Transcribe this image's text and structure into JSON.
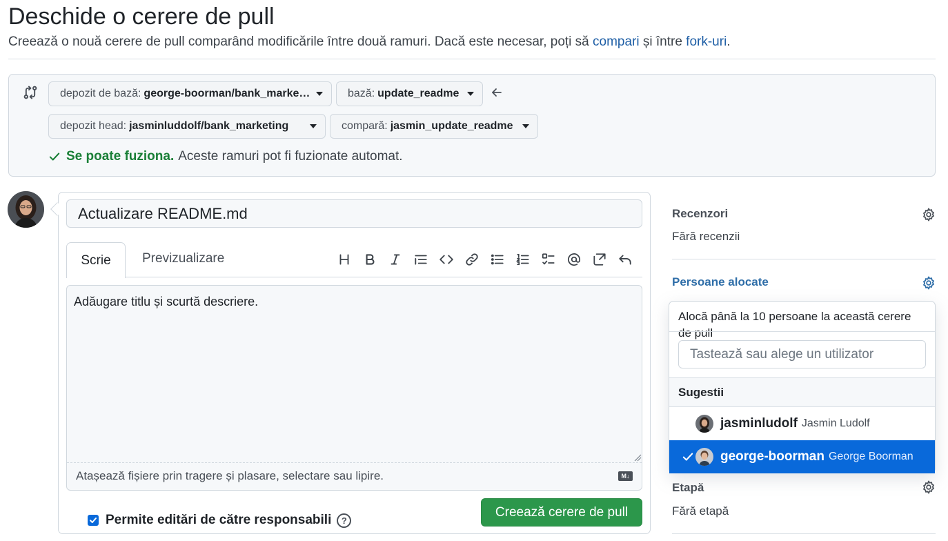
{
  "header": {
    "title": "Deschide o cerere de pull",
    "subtitle_before": "Creează o nouă cerere de pull comparând modificările între două ramuri. Dacă este necesar, poți să ",
    "link_compare": "compari",
    "subtitle_middle": " și între ",
    "link_forks": "fork-uri",
    "subtitle_after": "."
  },
  "compare": {
    "base_repo_prefix": "depozit de bază:",
    "base_repo_value": "george-boorman/bank_marketing",
    "base_prefix": "bază:",
    "base_value": "update_readme",
    "head_repo_prefix": "depozit head:",
    "head_repo_value": "jasminluddolf/bank_marketing",
    "compare_prefix": "compară:",
    "compare_value": "jasmin_update_readme",
    "merge_ok": "Se poate fuziona.",
    "merge_text": "Aceste ramuri pot fi fuzionate automat."
  },
  "form": {
    "title_value": "Actualizare README.md",
    "tab_write": "Scrie",
    "tab_preview": "Previzualizare",
    "toolbar_icons": [
      "heading-icon",
      "bold-icon",
      "italic-icon",
      "quote-icon",
      "code-icon",
      "link-icon",
      "bulleted-list-icon",
      "numbered-list-icon",
      "task-list-icon",
      "mention-icon",
      "reference-icon",
      "undo-icon"
    ],
    "body_value": "Adăugare titlu și scurtă descriere.",
    "attach_hint": "Atașează fișiere prin tragere și plasare, selectare sau lipire.",
    "markdown_badge": "M↓",
    "allow_edits_label": "Permite editări de către responsabili",
    "allow_edits_checked": true,
    "help_glyph": "?",
    "create_button": "Creează cerere de pull"
  },
  "sidebar": {
    "reviewers_label": "Recenzori",
    "reviewers_value": "Fără recenzii",
    "assignees_label": "Persoane alocate",
    "milestone_label": "Etapă",
    "milestone_value": "Fără etapă"
  },
  "assignee_dropdown": {
    "header": "Alocă până la 10 persoane la această cerere de pull",
    "filter_placeholder": "Tastează sau alege un utilizator",
    "section_label": "Sugestii",
    "users": [
      {
        "login": "jasminludolf",
        "name": "Jasmin Ludolf",
        "selected": false
      },
      {
        "login": "george-boorman",
        "name": "George Boorman",
        "selected": true
      }
    ]
  },
  "colors": {
    "accent": "#0969da",
    "success": "#1a7f37",
    "create_button": "#2c974b",
    "link": "#1f5fa6"
  }
}
